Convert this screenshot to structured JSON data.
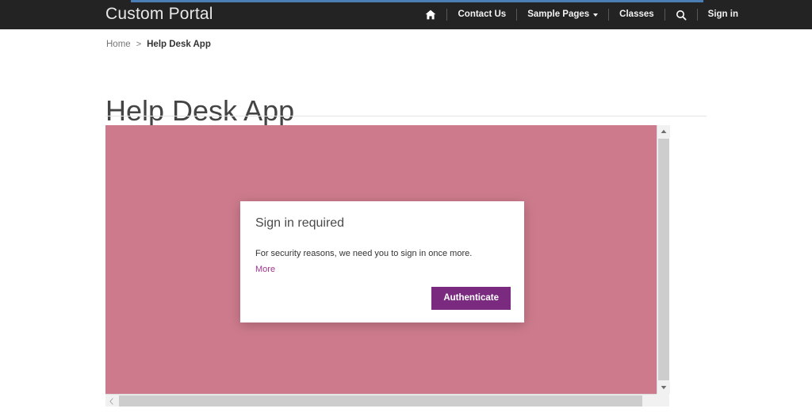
{
  "theme": {
    "header_bg": "#232323",
    "accent_blue": "#4b7eb5",
    "app_bg_pink": "#cd7b8c",
    "purple_button": "#7a2b80",
    "purple_link": "#a2358f"
  },
  "header": {
    "brand": "Custom Portal",
    "nav": [
      {
        "label": "",
        "icon": "home-icon",
        "name": "nav-home"
      },
      {
        "label": "Contact Us",
        "icon": "",
        "name": "nav-contact-us"
      },
      {
        "label": "Sample Pages",
        "icon": "chevron-down-icon",
        "name": "nav-sample-pages"
      },
      {
        "label": "Classes",
        "icon": "",
        "name": "nav-classes"
      },
      {
        "label": "",
        "icon": "search-icon",
        "name": "nav-search"
      },
      {
        "label": "Sign in",
        "icon": "",
        "name": "nav-sign-in"
      }
    ]
  },
  "breadcrumb": {
    "home_label": "Home",
    "separator": ">",
    "current_label": "Help Desk App"
  },
  "page": {
    "title": "Help Desk App"
  },
  "dialog": {
    "title": "Sign in required",
    "body": "For security reasons, we need you to sign in once more.",
    "more_label": "More",
    "action_label": "Authenticate"
  },
  "scrollbars": {
    "up_arrow": "chevron-up-icon",
    "down_arrow": "chevron-down-icon",
    "left_arrow": "chevron-left-icon",
    "right_arrow": "chevron-right-icon"
  }
}
